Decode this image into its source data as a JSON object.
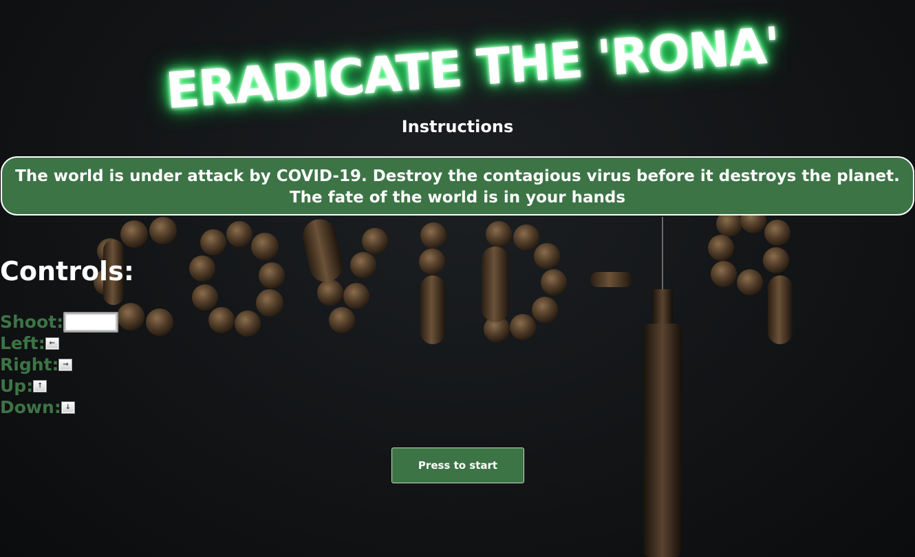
{
  "title": "ERADICATE THE 'RONA'",
  "instructions": {
    "heading": "Instructions",
    "story": "The world is under attack by COVID-19. Destroy the contagious virus before it destroys the planet. The fate of the world is in your hands"
  },
  "controls": {
    "heading": "Controls:",
    "items": [
      {
        "label": "Shoot:",
        "key": "space-key"
      },
      {
        "label": "Left:",
        "key": "left-arrow-key"
      },
      {
        "label": "Right:",
        "key": "right-arrow-key"
      },
      {
        "label": "Up:",
        "key": "up-arrow-key"
      },
      {
        "label": "Down:",
        "key": "down-arrow-key"
      }
    ],
    "arrows": {
      "left": "←",
      "right": "→",
      "up": "↑",
      "down": "↓"
    }
  },
  "start_button": {
    "label": "Press to start"
  },
  "colors": {
    "accent_green": "#3d7446",
    "title_glow": "#2cff6e",
    "background": "#121416"
  }
}
